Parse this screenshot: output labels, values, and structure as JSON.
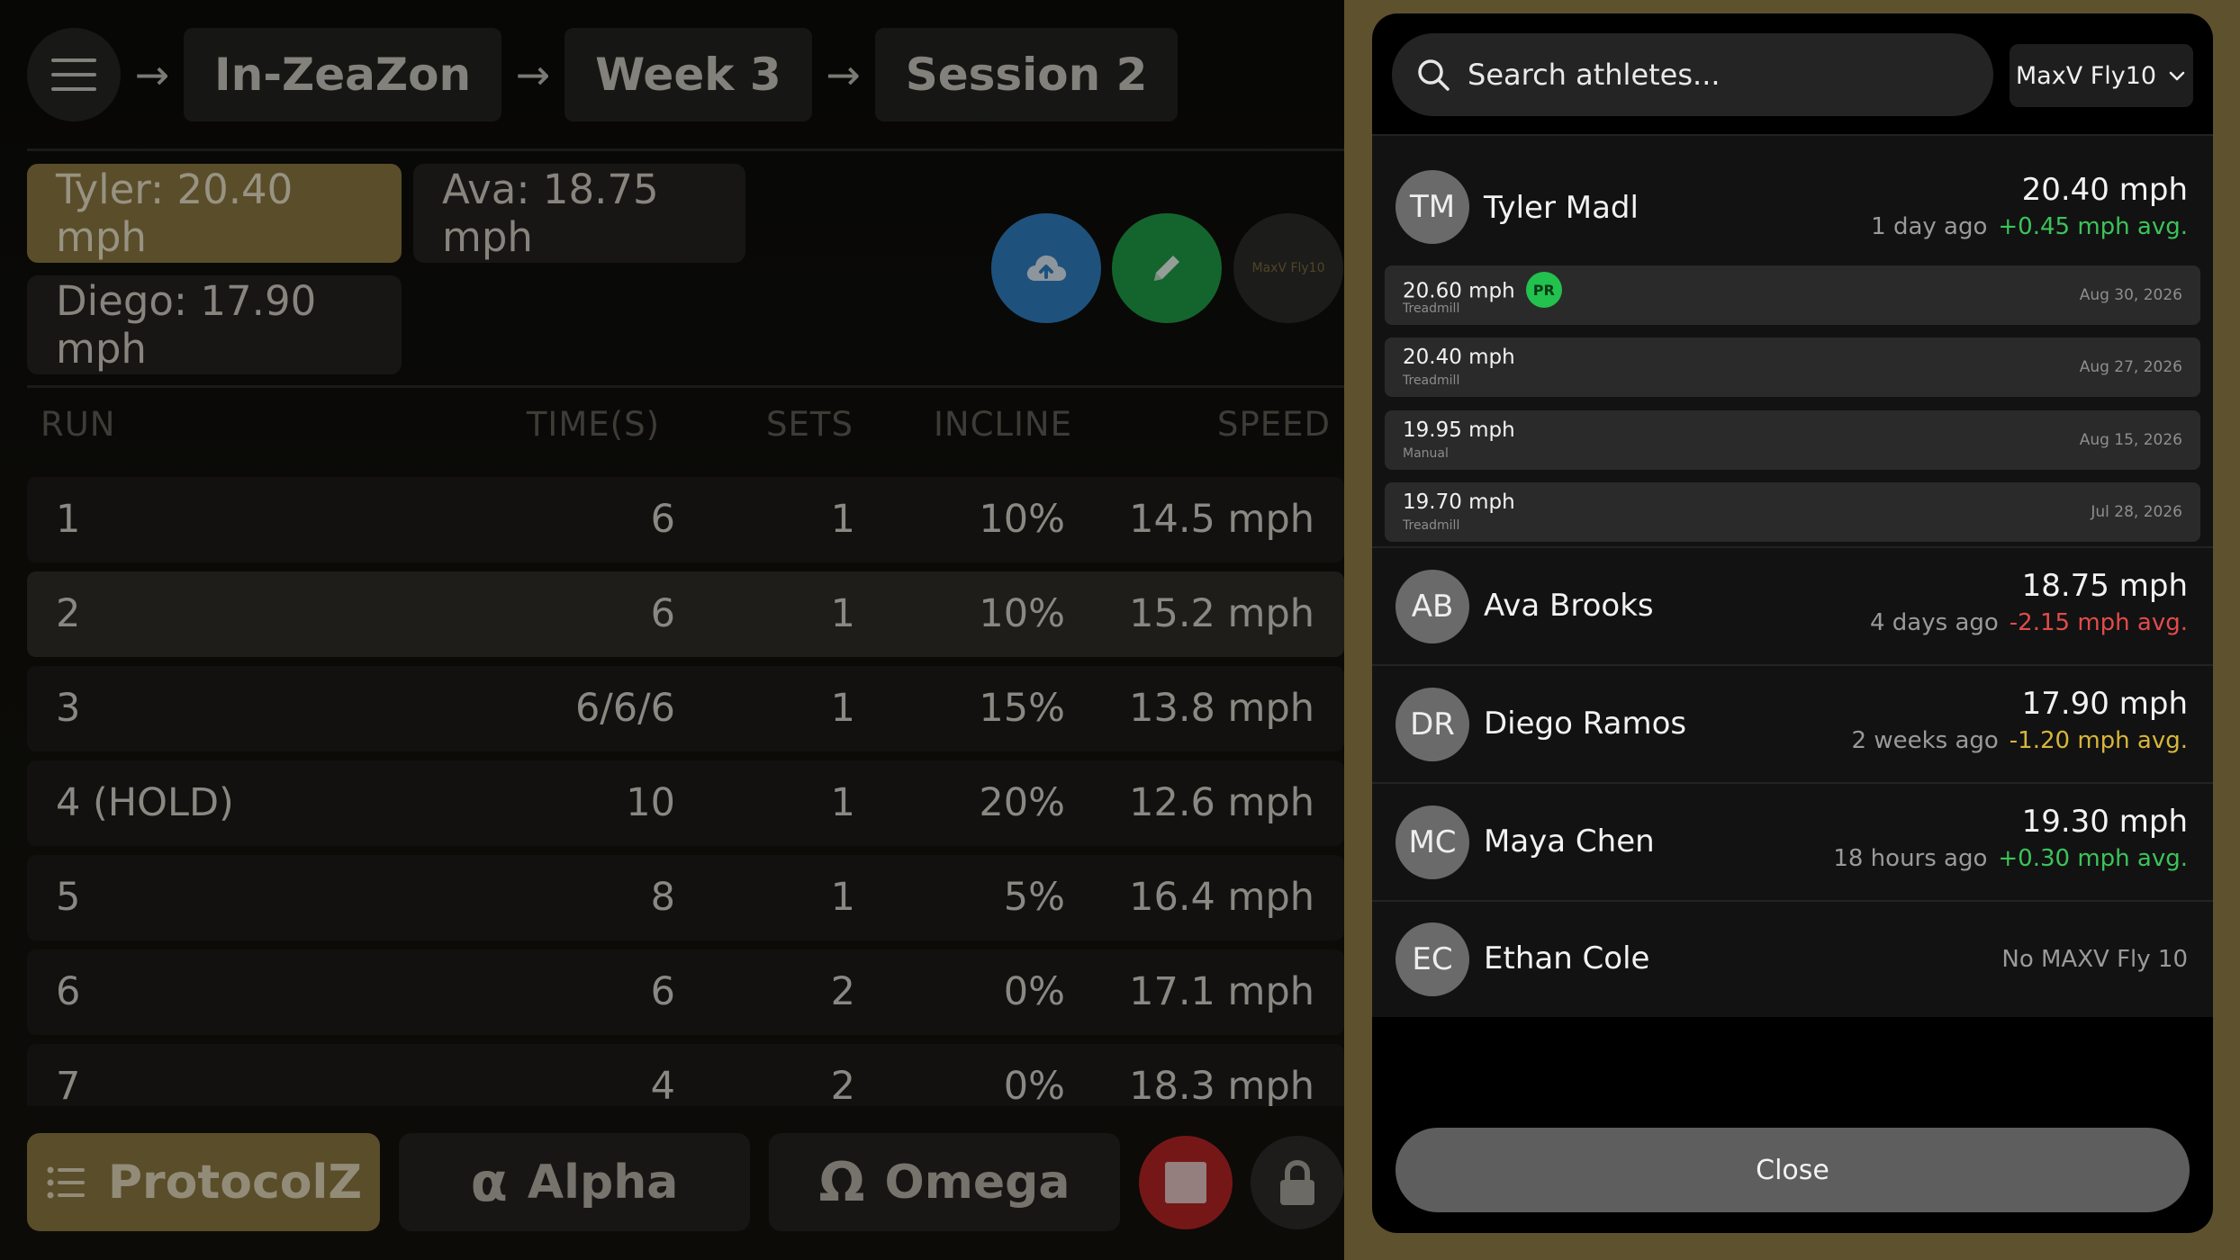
{
  "breadcrumb": {
    "items": [
      "In-ZeaZon",
      "Week 3",
      "Session 2"
    ]
  },
  "chips": [
    {
      "label": "Tyler: 20.40 mph",
      "active": true
    },
    {
      "label": "Ava: 18.75 mph",
      "active": false
    },
    {
      "label": "Diego: 17.90 mph",
      "active": false
    }
  ],
  "action_buttons": {
    "upload_icon": "cloud-upload-icon",
    "edit_icon": "pencil-icon",
    "metric_label": "MaxV Fly10"
  },
  "table": {
    "headers": [
      "RUN",
      "TIME(S)",
      "SETS",
      "INCLINE",
      "SPEED"
    ],
    "rows": [
      [
        "1",
        "6",
        "1",
        "10%",
        "14.5 mph"
      ],
      [
        "2",
        "6",
        "1",
        "10%",
        "15.2 mph"
      ],
      [
        "3",
        "6/6/6",
        "1",
        "15%",
        "13.8 mph"
      ],
      [
        "4 (HOLD)",
        "10",
        "1",
        "20%",
        "12.6 mph"
      ],
      [
        "5",
        "8",
        "1",
        "5%",
        "16.4 mph"
      ],
      [
        "6",
        "6",
        "2",
        "0%",
        "17.1 mph"
      ],
      [
        "7",
        "4",
        "2",
        "0%",
        "18.3 mph"
      ]
    ],
    "selected_row": 1
  },
  "bottom_bar": {
    "protocolz": "ProtocolZ",
    "alpha": "Alpha",
    "alpha_glyph": "α",
    "omega": "Omega",
    "omega_glyph": "Ω"
  },
  "panel": {
    "search_placeholder": "Search athletes...",
    "metric_select": "MaxV Fly10",
    "athletes": [
      {
        "initials": "TM",
        "name": "Tyler Madl",
        "speed": "20.40 mph",
        "ago": "1 day ago",
        "delta": "+0.45 mph avg.",
        "delta_color": "pos"
      },
      {
        "initials": "AB",
        "name": "Ava Brooks",
        "speed": "18.75 mph",
        "ago": "4 days ago",
        "delta": "-2.15 mph avg.",
        "delta_color": "neg"
      },
      {
        "initials": "DR",
        "name": "Diego Ramos",
        "speed": "17.90 mph",
        "ago": "2 weeks ago",
        "delta": "-1.20 mph avg.",
        "delta_color": "warn"
      },
      {
        "initials": "MC",
        "name": "Maya Chen",
        "speed": "19.30 mph",
        "ago": "18 hours ago",
        "delta": "+0.30 mph avg.",
        "delta_color": "pos"
      },
      {
        "initials": "EC",
        "name": "Ethan Cole",
        "none_text": "No MAXV Fly 10"
      }
    ],
    "tyler_records": [
      {
        "value": "20.60 mph",
        "source": "Treadmill",
        "date": "Aug 30, 2026",
        "pr": "PR"
      },
      {
        "value": "20.40 mph",
        "source": "Treadmill",
        "date": "Aug 27, 2026"
      },
      {
        "value": "19.95 mph",
        "source": "Manual",
        "date": "Aug 15, 2026"
      },
      {
        "value": "19.70 mph",
        "source": "Treadmill",
        "date": "Jul 28, 2026"
      }
    ],
    "close_label": "Close"
  },
  "colors": {
    "gold": "#8a7740",
    "blue": "#2f7ec0",
    "green": "#1f9b45",
    "red": "#b62424",
    "pr_green": "#23c14d"
  }
}
